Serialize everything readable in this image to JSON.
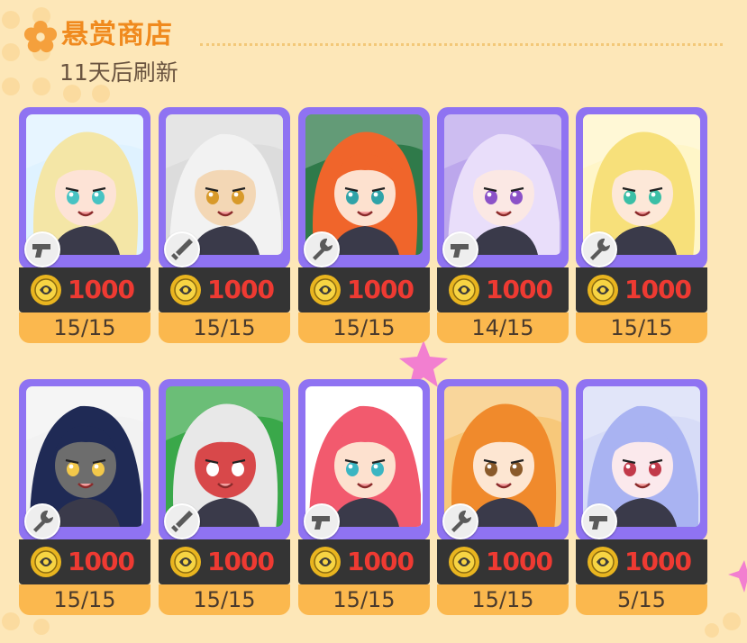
{
  "header": {
    "title": "悬赏商店",
    "refresh_text": "11天后刷新"
  },
  "colors": {
    "background": "#fde7b8",
    "title": "#f08a1e",
    "card_frame": "#8f73f2",
    "price_bar": "#343434",
    "price_text": "#ee3a32",
    "stock_bar": "#fbb84e"
  },
  "shop": {
    "items": [
      {
        "price": "1000",
        "stock": "15/15",
        "skill_icon": "pistol-icon",
        "hair": "#f4e6a6",
        "skin": "#fde3d6",
        "eye": "#47c3c3",
        "bg": "#dff2ff"
      },
      {
        "price": "1000",
        "stock": "15/15",
        "skill_icon": "sword-icon",
        "hair": "#f2f2f2",
        "skin": "#f3d7b5",
        "eye": "#d89a2a",
        "bg": "#dcdcdc"
      },
      {
        "price": "1000",
        "stock": "15/15",
        "skill_icon": "wrench-icon",
        "hair": "#f0652b",
        "skin": "#fde1cf",
        "eye": "#30a3a8",
        "bg": "#2f7a4a"
      },
      {
        "price": "1000",
        "stock": "14/15",
        "skill_icon": "pistol-icon",
        "hair": "#e9defa",
        "skin": "#fbe8e4",
        "eye": "#8b52c8",
        "bg": "#bca7ec"
      },
      {
        "price": "1000",
        "stock": "15/15",
        "skill_icon": "wrench-icon",
        "hair": "#f7e07a",
        "skin": "#fde8d8",
        "eye": "#3bbfa6",
        "bg": "#fff6c8"
      },
      {
        "price": "1000",
        "stock": "15/15",
        "skill_icon": "wrench-icon",
        "hair": "#1f2a55",
        "skin": "#6d6d6d",
        "eye": "#f2c84a",
        "bg": "#f2f2f2"
      },
      {
        "price": "1000",
        "stock": "15/15",
        "skill_icon": "sword-icon",
        "hair": "#e8e8e8",
        "skin": "#d8484a",
        "eye": "#ffffff",
        "bg": "#3aa84a"
      },
      {
        "price": "1000",
        "stock": "15/15",
        "skill_icon": "pistol-icon",
        "hair": "#f25a6e",
        "skin": "#fde1cf",
        "eye": "#3bb5c2",
        "bg": "#ffffff"
      },
      {
        "price": "1000",
        "stock": "15/15",
        "skill_icon": "wrench-icon",
        "hair": "#f08a2c",
        "skin": "#fde6d2",
        "eye": "#8a5a2a",
        "bg": "#f7c87a"
      },
      {
        "price": "1000",
        "stock": "5/15",
        "skill_icon": "pistol-icon",
        "hair": "#a9b3f2",
        "skin": "#fbe9ec",
        "eye": "#c23a4a",
        "bg": "#d7dcf7"
      }
    ]
  }
}
